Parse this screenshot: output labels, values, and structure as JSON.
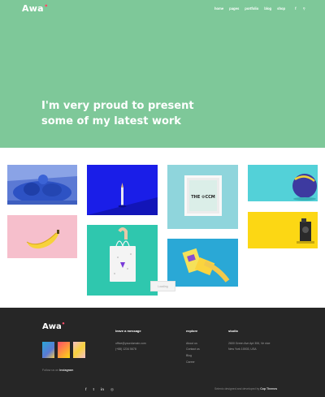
{
  "brand": {
    "name": "Awa",
    "dot": "•"
  },
  "nav": {
    "items": [
      "home",
      "pages",
      "portfolio",
      "blog",
      "shop"
    ],
    "facebook": "f",
    "search": "⚲"
  },
  "hero": {
    "title": "I'm very proud to present some of my latest work",
    "background": "#7ec899"
  },
  "gallery": {
    "loading_label": "Loading"
  },
  "footer": {
    "follow_prefix": "Follow us on ",
    "follow_link": "Instagram",
    "leave_message": {
      "heading": "leave a message",
      "email": "office@yourdomain.com",
      "phone": "(+88) 1234 5678"
    },
    "explore": {
      "heading": "explore",
      "links": [
        "About us",
        "Contact us",
        "Blog",
        "Career"
      ]
    },
    "studio": {
      "heading": "studio",
      "address_line1": "2600 Green Ave Apt 306, Ve nice",
      "address_line2": "New York 10003, USA"
    },
    "social": [
      "f",
      "t",
      "in",
      "◎"
    ],
    "credits_prefix": "Selenic designed and developed by ",
    "credits_author": "Cop Themes"
  }
}
